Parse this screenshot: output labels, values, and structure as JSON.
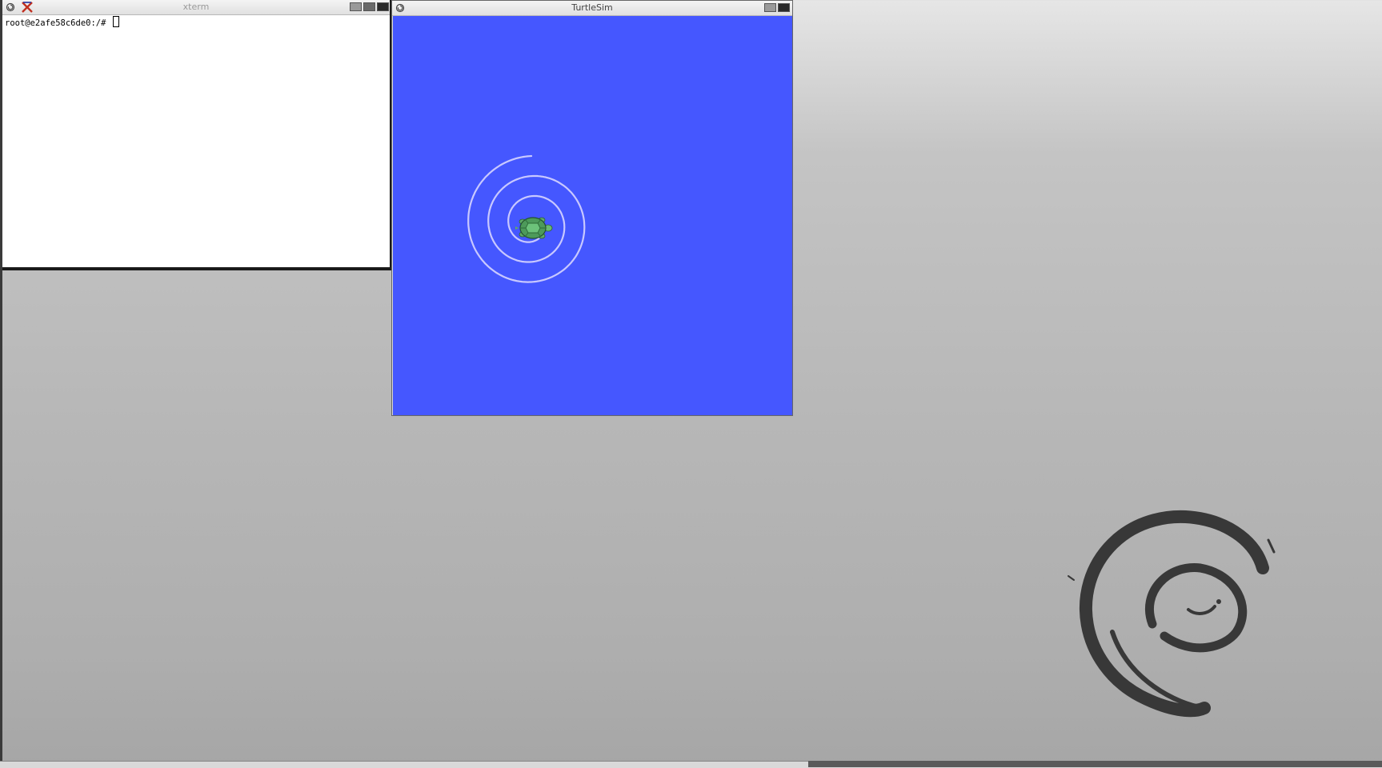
{
  "xterm": {
    "title": "xterm",
    "prompt": "root@e2afe58c6de0:/# "
  },
  "turtlesim": {
    "title": "TurtleSim",
    "background_color": "#4557ff",
    "trail_color": "#c8c8ff"
  },
  "desktop": {
    "background_color": "#b5b5b5",
    "logo_color": "#383838"
  }
}
